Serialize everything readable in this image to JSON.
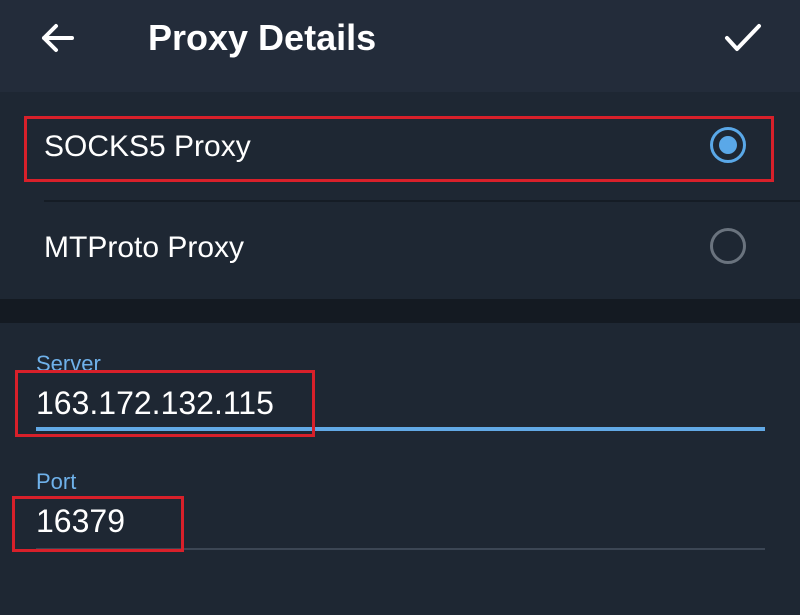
{
  "header": {
    "title": "Proxy Details",
    "back_icon": "arrow-left-icon",
    "done_icon": "checkmark-icon"
  },
  "proxy_types": [
    {
      "label": "SOCKS5 Proxy",
      "selected": true
    },
    {
      "label": "MTProto Proxy",
      "selected": false
    }
  ],
  "fields": {
    "server": {
      "label": "Server",
      "value": "163.172.132.115"
    },
    "port": {
      "label": "Port",
      "value": "16379"
    }
  },
  "colors": {
    "accent": "#5aa8e8",
    "highlight": "#d8202a",
    "background": "#1a222d"
  }
}
